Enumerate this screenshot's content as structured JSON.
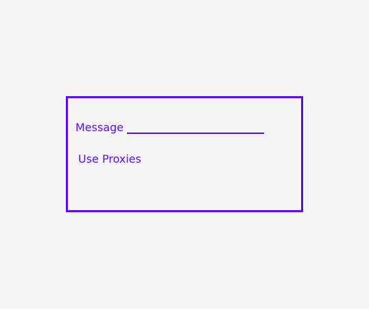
{
  "dialog": {
    "message_label": "Message",
    "message_value": "",
    "use_proxies_label": "Use Proxies"
  },
  "colors": {
    "accent": "#5a0fe0",
    "background": "#f4f4f4"
  }
}
